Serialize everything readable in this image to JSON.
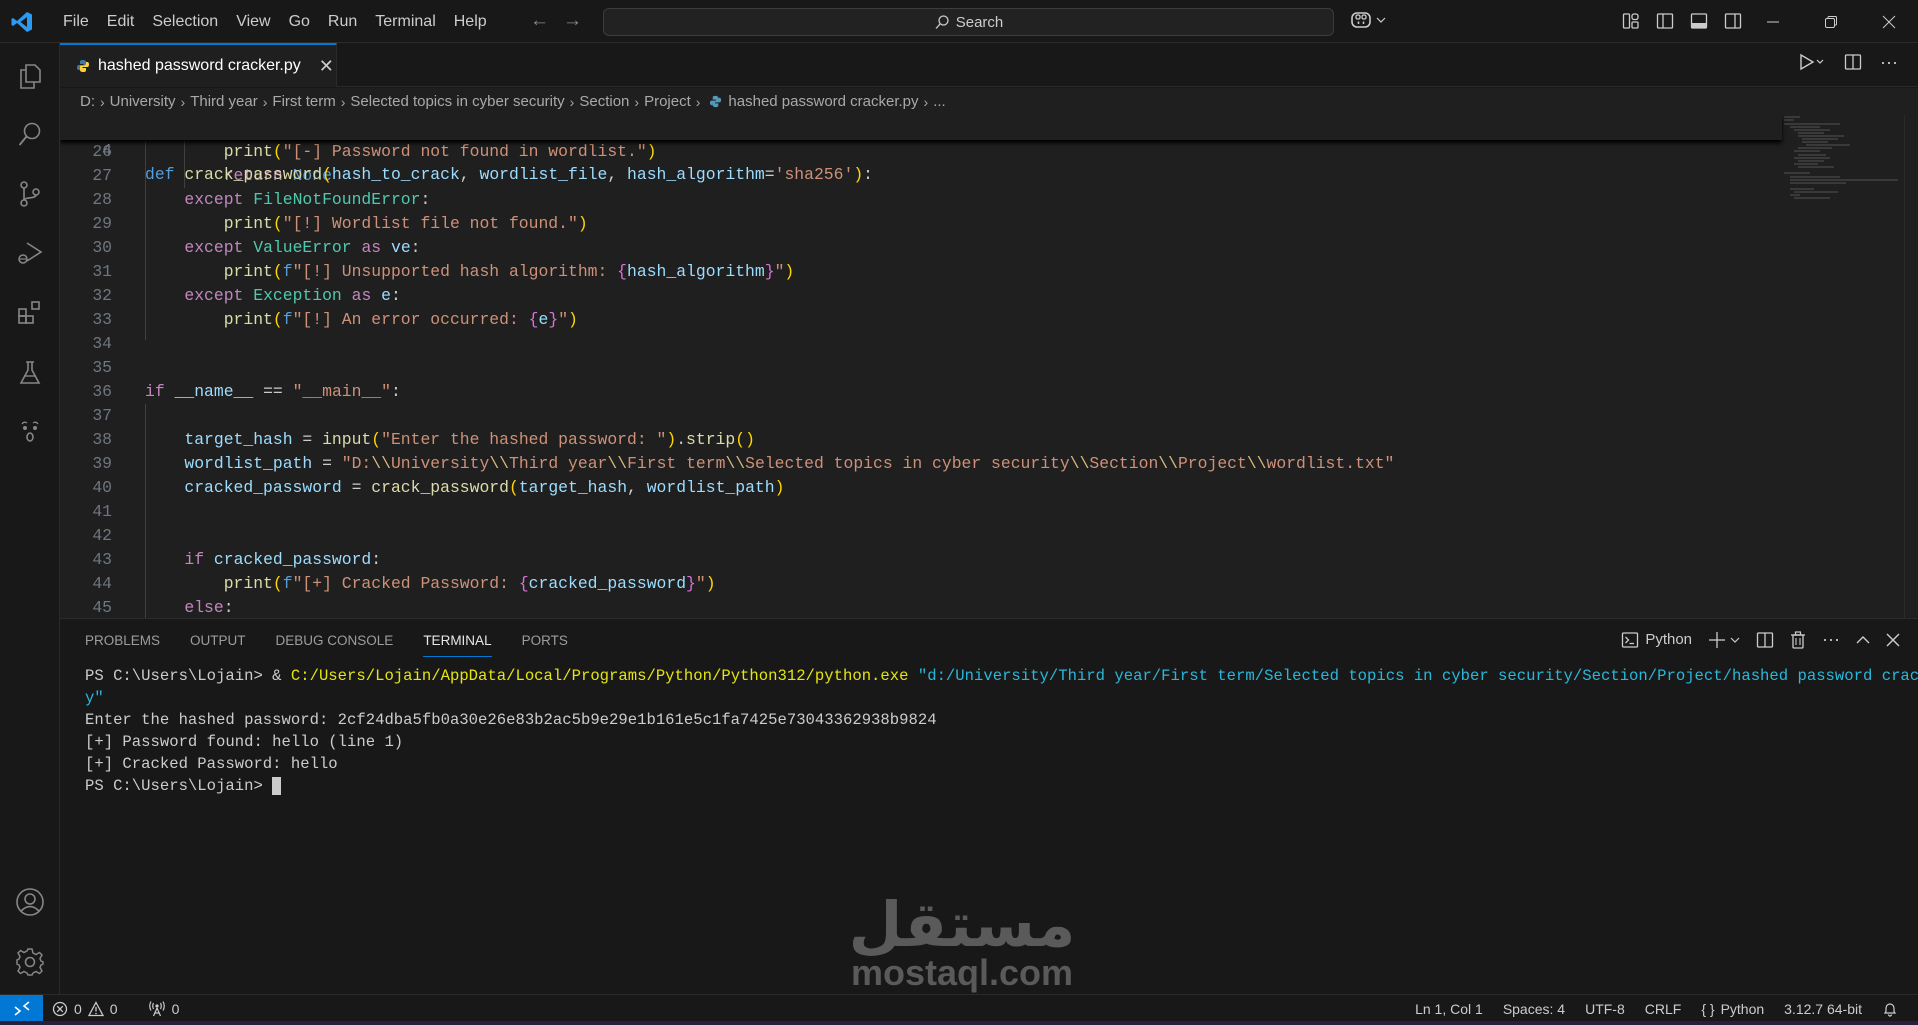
{
  "titlebar": {
    "menu": [
      "File",
      "Edit",
      "Selection",
      "View",
      "Go",
      "Run",
      "Terminal",
      "Help"
    ],
    "search_label": "Search"
  },
  "tab": {
    "filename": "hashed password cracker.py"
  },
  "breadcrumb": [
    "D:",
    "University",
    "Third year",
    "First term",
    "Selected topics in cyber security",
    "Section",
    "Project",
    "hashed password cracker.py",
    "..."
  ],
  "editor": {
    "sticky_line": {
      "number": "4",
      "text": "def crack_password(hash_to_crack, wordlist_file, hash_algorithm='sha256'):"
    },
    "lines": [
      {
        "number": "26",
        "text": "        print(\"[-] Password not found in wordlist.\")"
      },
      {
        "number": "27",
        "text": "        return None"
      },
      {
        "number": "28",
        "text": "    except FileNotFoundError:"
      },
      {
        "number": "29",
        "text": "        print(\"[!] Wordlist file not found.\")"
      },
      {
        "number": "30",
        "text": "    except ValueError as ve:"
      },
      {
        "number": "31",
        "text": "        print(f\"[!] Unsupported hash algorithm: {hash_algorithm}\")"
      },
      {
        "number": "32",
        "text": "    except Exception as e:"
      },
      {
        "number": "33",
        "text": "        print(f\"[!] An error occurred: {e}\")"
      },
      {
        "number": "34",
        "text": ""
      },
      {
        "number": "35",
        "text": ""
      },
      {
        "number": "36",
        "text": "if __name__ == \"__main__\":"
      },
      {
        "number": "37",
        "text": ""
      },
      {
        "number": "38",
        "text": "    target_hash = input(\"Enter the hashed password: \").strip()"
      },
      {
        "number": "39",
        "text": "    wordlist_path = \"D:\\\\University\\\\Third year\\\\First term\\\\Selected topics in cyber security\\\\Section\\\\Project\\\\wordlist.txt\""
      },
      {
        "number": "40",
        "text": "    cracked_password = crack_password(target_hash, wordlist_path)"
      },
      {
        "number": "41",
        "text": ""
      },
      {
        "number": "42",
        "text": ""
      },
      {
        "number": "43",
        "text": "    if cracked_password:"
      },
      {
        "number": "44",
        "text": "        print(f\"[+] Cracked Password: {cracked_password}\")"
      },
      {
        "number": "45",
        "text": "    else:"
      }
    ]
  },
  "panel": {
    "tabs": [
      "PROBLEMS",
      "OUTPUT",
      "DEBUG CONSOLE",
      "TERMINAL",
      "PORTS"
    ],
    "active_tab": "TERMINAL",
    "terminal_name": "Python",
    "terminal": {
      "prompt": "PS C:\\Users\\Lojain> ",
      "cmd_amp": "& ",
      "cmd_exe": "C:/Users/Lojain/AppData/Local/Programs/Python/Python312/python.exe",
      "cmd_arg": " \"d:/University/Third year/First term/Selected topics in cyber security/Section/Project/hashed password cracker.p",
      "cmd_arg_wrap": "y\"",
      "output": [
        "Enter the hashed password: 2cf24dba5fb0a30e26e83b2ac5b9e29e1b161e5c1fa7425e73043362938b9824",
        "[+] Password found: hello (line 1)",
        "[+] Cracked Password: hello"
      ],
      "final_prompt": "PS C:\\Users\\Lojain> "
    }
  },
  "watermark": {
    "arabic": "مستقل",
    "latin": "mostaql.com"
  },
  "statusbar": {
    "errors": "0",
    "warnings": "0",
    "ports": "0",
    "position": "Ln 1, Col 1",
    "spaces": "Spaces: 4",
    "encoding": "UTF-8",
    "eol": "CRLF",
    "language": "Python",
    "interpreter": "3.12.7 64-bit"
  },
  "colors": {
    "accent": "#0078d4",
    "background": "#1f1f1f",
    "chrome": "#181818"
  }
}
